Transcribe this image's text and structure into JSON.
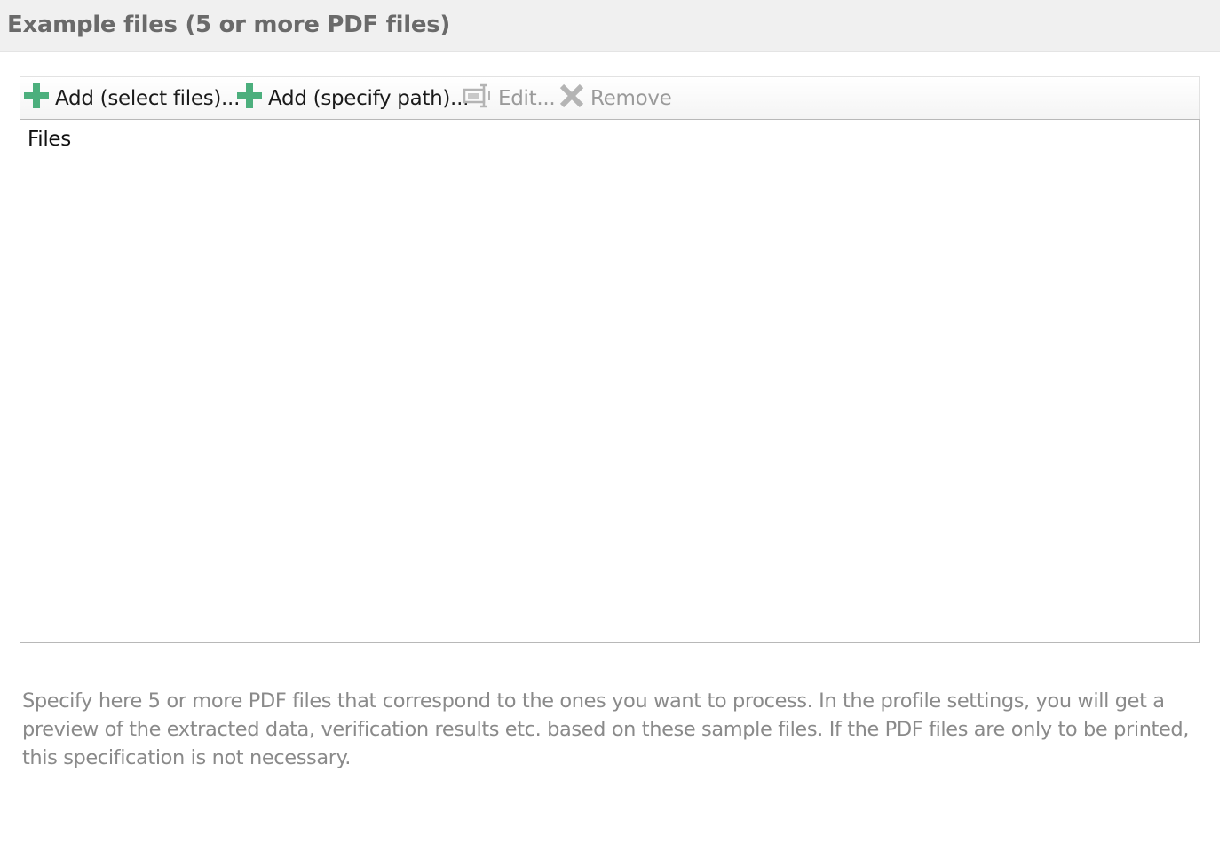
{
  "header": {
    "title": "Example files (5 or more PDF files)"
  },
  "toolbar": {
    "add_files_label": "Add (select files)...",
    "add_path_label": "Add (specify path)...",
    "edit_label": "Edit...",
    "remove_label": "Remove",
    "add_icon": "plus-icon",
    "edit_icon": "edit-field-icon",
    "remove_icon": "x-icon",
    "add_icon_color": "#4caf7d",
    "disabled_color": "#9a9a9a"
  },
  "list": {
    "columns": [
      "Files"
    ],
    "rows": []
  },
  "description": "Specify here 5 or more PDF files that correspond to the ones you want to process. In the profile settings, you will get a preview of the extracted data, verification results etc. based on these sample files. If the PDF files are only to be printed, this specification is not necessary."
}
